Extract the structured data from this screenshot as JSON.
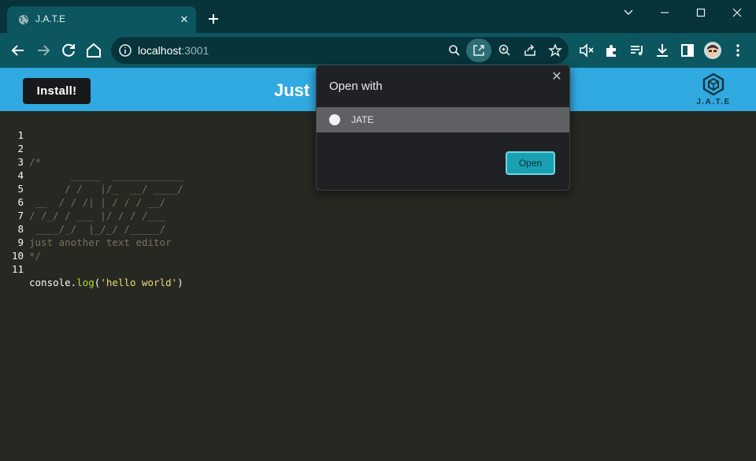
{
  "browser": {
    "tab_title": "J.A.T.E",
    "url_host": "localhost",
    "url_port": ":3001"
  },
  "app": {
    "install_label": "Install!",
    "title": "Just",
    "logo_text": "J.A.T.E"
  },
  "editor": {
    "lines": [
      {
        "n": "1",
        "text": ""
      },
      {
        "n": "2",
        "text": "/*"
      },
      {
        "n": "3",
        "text": "       _____  ____________"
      },
      {
        "n": "4",
        "text": "      / /   |/_  __/ ____/"
      },
      {
        "n": "5",
        "text": " __  / / /| | / / / __/"
      },
      {
        "n": "6",
        "text": "/ /_/ / ___ |/ / / /___"
      },
      {
        "n": "7",
        "text": " ____/_/  |_/_/ /_____/"
      },
      {
        "n": "8",
        "text": "just another text editor"
      },
      {
        "n": "9",
        "text": "*/"
      },
      {
        "n": "10",
        "text": ""
      },
      {
        "n": "11",
        "text": ""
      }
    ],
    "code_obj": "console.",
    "code_fn": "log",
    "code_open": "(",
    "code_str": "'hello world'",
    "code_close": ")"
  },
  "popup": {
    "title": "Open with",
    "app_name": "JATE",
    "open_label": "Open"
  },
  "colors": {
    "chrome_dark": "#06343a",
    "chrome_toolbar": "#0c5660",
    "app_header": "#31a9e1",
    "editor_bg": "#272822",
    "open_button": "#1aa0b3"
  }
}
